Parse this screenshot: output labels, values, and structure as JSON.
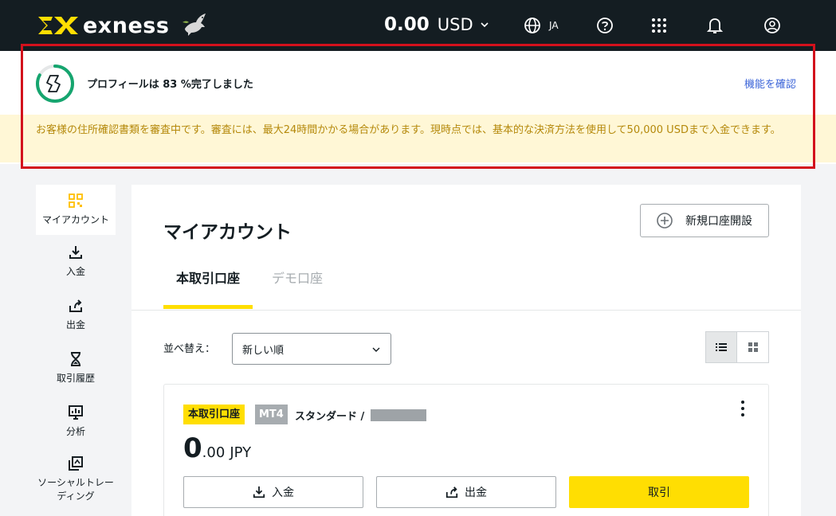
{
  "brand": {
    "name": "exness"
  },
  "header": {
    "balance_amount": "0.00",
    "balance_currency": "USD",
    "language": "JA"
  },
  "profile": {
    "progress_percent": 83,
    "status_text": "プロフィールは 83 %完了しました",
    "check_link": "機能を確認",
    "notice": "お客様の住所確認書類を審査中です。審査には、最大24時間かかる場合があります。現時点では、基本的な決済方法を使用して50,000 USDまで入金できます。"
  },
  "sidebar": {
    "items": [
      {
        "label": "マイアカウント",
        "icon": "grid-icon",
        "active": true
      },
      {
        "label": "入金",
        "icon": "download-icon"
      },
      {
        "label": "出金",
        "icon": "upload-icon"
      },
      {
        "label": "取引履歴",
        "icon": "hourglass-icon"
      },
      {
        "label": "分析",
        "icon": "chart-icon"
      },
      {
        "label": "ソーシャルトレーディング",
        "icon": "copy-icon"
      }
    ]
  },
  "main": {
    "title": "マイアカウント",
    "new_account_label": "新規口座開設",
    "tabs": [
      {
        "label": "本取引口座",
        "active": true
      },
      {
        "label": "デモ口座",
        "active": false
      }
    ],
    "sort_label": "並べ替え：",
    "sort_value": "新しい順"
  },
  "account": {
    "badge": "本取引口座",
    "platform": "MT4",
    "type": "スタンダード /",
    "balance_int": "0",
    "balance_dec": ".00",
    "currency": "JPY",
    "deposit_label": "入金",
    "withdraw_label": "出金",
    "trade_label": "取引"
  },
  "colors": {
    "header_bg": "#141d22",
    "accent_yellow": "#ffde02",
    "link_blue": "#3b64d8",
    "progress_green": "#16a56f",
    "notice_bg": "#fff7d6",
    "notice_text": "#b5890b",
    "highlight_red": "#d3111c"
  }
}
